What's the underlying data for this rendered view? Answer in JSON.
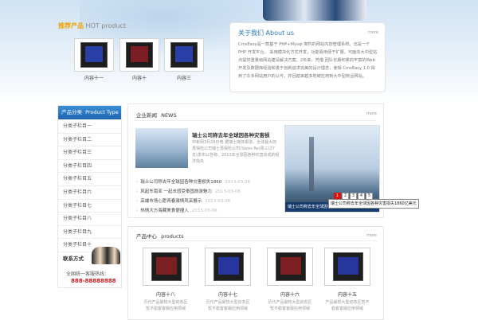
{
  "recommend": {
    "title_cn": "推荐产品",
    "title_en": "HOT product",
    "items": [
      {
        "name": "内容十一",
        "screen": "blue"
      },
      {
        "name": "内容十",
        "screen": "red"
      },
      {
        "name": "内容三",
        "screen": "blue"
      }
    ]
  },
  "about": {
    "title_cn": "关于我们",
    "title_en": "About us",
    "more": "more",
    "text": "CmsEasy是一款基于 PHP+Mysql 架构的网站内容管理系统，也是一个 PHP 开发平台。 采用模块化方式开发，功能易用便于扩展，可面向大中型站点提供重量级网站建设解决方案。2年来，凭借 团队长期积累的丰富的Web开发及数据库经验和勇于创新追求完美的设计理念，使得 CmsEasy 1.0 得到了众多网站用户的认可，并且越来越多地被应用到大中型商业网站。"
  },
  "sidebar": {
    "cat_title_cn": "产品分类",
    "cat_title_en": "Product Type",
    "categories": [
      "分类子栏目一",
      "分类子栏目二",
      "分类子栏目三",
      "分类子栏目四",
      "分类子栏目五",
      "分类子栏目六",
      "分类子栏目七",
      "分类子栏目八",
      "分类子栏目九",
      "分类子栏目十"
    ],
    "contact_title": "联系方式",
    "hotline_label": "全国统一客服热线：",
    "hotline": "888-88888888"
  },
  "news": {
    "title_cn": "企业新闻",
    "title_en": "NEWS",
    "more": "more",
    "feature_title": "瑞士公司称去年全球因各种灾害损",
    "feature_body": "中新网3月26日电 据瑞士媒体报道，全球最大的再保险公司瑞士再保险公司(Swiss Re)周三(27日)发布公告称，2013年全球因各种灾害造成的经济损失",
    "items": [
      {
        "title": "瑞士公司称去年全球因各种灾害损失1860",
        "date": "2013-03-26"
      },
      {
        "title": "风起东南亚 一起去感受泰国旅游魅力",
        "date": "2013-03-06"
      },
      {
        "title": "高端市场心愿青春激情风采展示",
        "date": "2013-03-06"
      },
      {
        "title": "热情大方海藏美食便捷入",
        "date": "2013-03-06"
      }
    ],
    "slide_caption": "瑞士公司称去年全球因各种灾害损失1860亿美元",
    "pager": [
      "1",
      "2",
      "3",
      "4",
      "5"
    ],
    "tooltip": "瑞士公司称去年全球因各种灾害损失1860亿美元"
  },
  "products": {
    "title_cn": "产品中心",
    "title_en": "products",
    "more": "more",
    "items": [
      {
        "name": "内容十八",
        "desc": "历代产品最较大型动态区暂不稳客客版应用领域",
        "screen": "red"
      },
      {
        "name": "内容十七",
        "desc": "历代产品最较大型动态区暂不稳客客版应用领域",
        "screen": "blue"
      },
      {
        "name": "内容十六",
        "desc": "历代产品最较大型动态区暂不稳客客版应用领域",
        "screen": "red"
      },
      {
        "name": "内容十五",
        "desc": "产品最较大型动态区暂不稳客客版应用领域",
        "screen": "blue"
      }
    ]
  }
}
